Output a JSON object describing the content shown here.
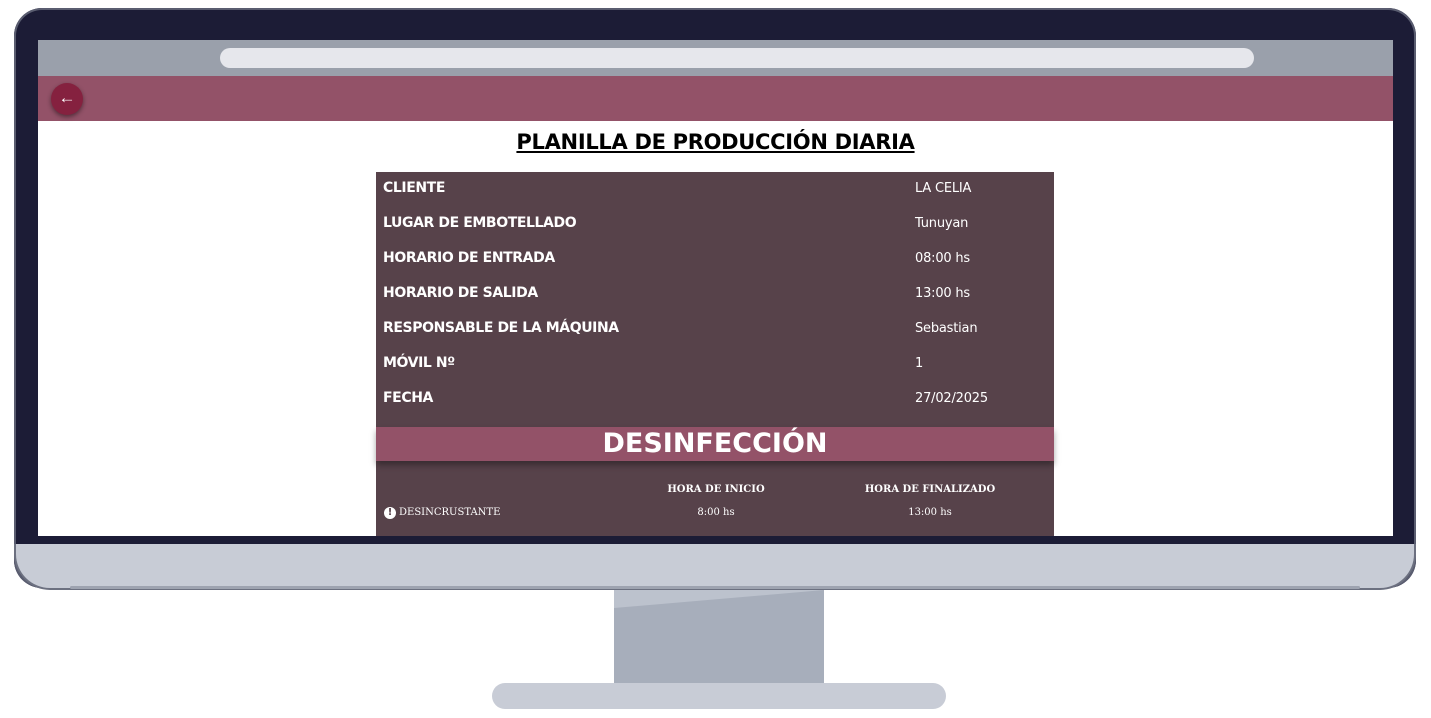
{
  "page": {
    "title": "PLANILLA DE PRODUCCIÓN DIARIA",
    "back_icon": "arrow-left-icon"
  },
  "colors": {
    "header": "#935268",
    "card": "#57424a",
    "back_button": "#85213f"
  },
  "info": [
    {
      "label": "CLIENTE",
      "value": "LA CELIA"
    },
    {
      "label": "LUGAR DE EMBOTELLADO",
      "value": "Tunuyan"
    },
    {
      "label": "HORARIO DE ENTRADA",
      "value": "08:00 hs"
    },
    {
      "label": "HORARIO DE SALIDA",
      "value": "13:00 hs"
    },
    {
      "label": "RESPONSABLE DE LA MÁQUINA",
      "value": "Sebastian"
    },
    {
      "label": "MÓVIL Nº",
      "value": "1"
    },
    {
      "label": "FECHA",
      "value": "27/02/2025"
    }
  ],
  "section": {
    "title": "DESINFECCIÓN",
    "columns": [
      "HORA DE INICIO",
      "HORA DE FINALIZADO"
    ],
    "rows": [
      {
        "icon": "info-icon",
        "label": "DESINCRUSTANTE",
        "start": "8:00 hs",
        "end": "13:00 hs"
      }
    ]
  }
}
